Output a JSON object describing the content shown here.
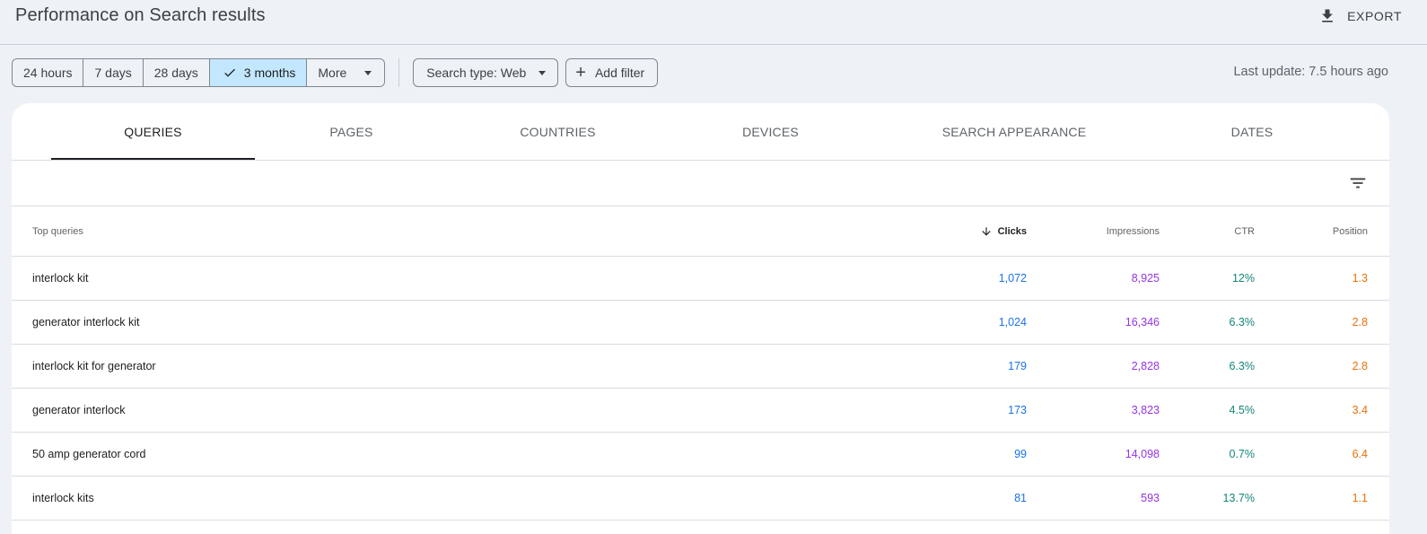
{
  "header": {
    "title": "Performance on Search results",
    "export_label": "EXPORT"
  },
  "filters": {
    "date_ranges": [
      "24 hours",
      "7 days",
      "28 days",
      "3 months"
    ],
    "active_range": "3 months",
    "more_label": "More",
    "search_type_label": "Search type: Web",
    "add_filter_label": "Add filter",
    "last_update": "Last update: 7.5 hours ago"
  },
  "tabs": [
    "QUERIES",
    "PAGES",
    "COUNTRIES",
    "DEVICES",
    "SEARCH APPEARANCE",
    "DATES"
  ],
  "active_tab": "QUERIES",
  "table": {
    "columns": {
      "query": "Top queries",
      "clicks": "Clicks",
      "impressions": "Impressions",
      "ctr": "CTR",
      "position": "Position"
    },
    "sort_column": "Clicks",
    "sort_direction": "descending",
    "rows": [
      {
        "query": "interlock kit",
        "clicks": "1,072",
        "impressions": "8,925",
        "ctr": "12%",
        "position": "1.3"
      },
      {
        "query": "generator interlock kit",
        "clicks": "1,024",
        "impressions": "16,346",
        "ctr": "6.3%",
        "position": "2.8"
      },
      {
        "query": "interlock kit for generator",
        "clicks": "179",
        "impressions": "2,828",
        "ctr": "6.3%",
        "position": "2.8"
      },
      {
        "query": "generator interlock",
        "clicks": "173",
        "impressions": "3,823",
        "ctr": "4.5%",
        "position": "3.4"
      },
      {
        "query": "50 amp generator cord",
        "clicks": "99",
        "impressions": "14,098",
        "ctr": "0.7%",
        "position": "6.4"
      },
      {
        "query": "interlock kits",
        "clicks": "81",
        "impressions": "593",
        "ctr": "13.7%",
        "position": "1.1"
      }
    ]
  },
  "colors": {
    "clicks": "#1a73e8",
    "impressions": "#9334e6",
    "ctr": "#12857a",
    "position": "#e8710a",
    "active_range_bg": "#c2e7ff"
  },
  "icons": {
    "export": "download-icon",
    "check": "check-icon",
    "more": "dropdown-caret-icon",
    "add_filter": "plus-icon",
    "table_filter": "filter-list-icon",
    "sort": "arrow-down-icon"
  }
}
